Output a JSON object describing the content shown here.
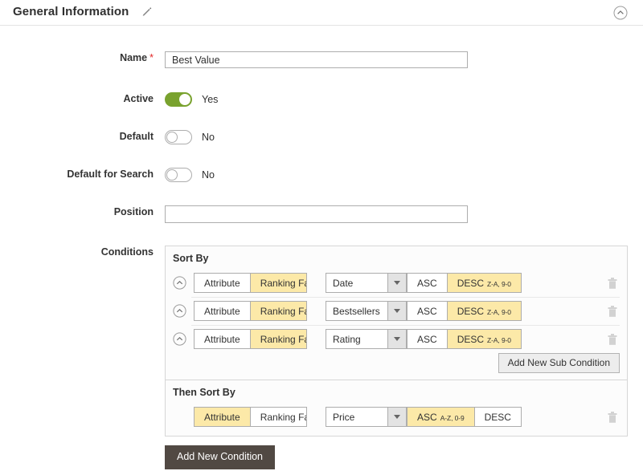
{
  "header": {
    "title": "General Information",
    "edit_icon": "pencil-icon",
    "collapse_icon": "chevron-up-circle-icon"
  },
  "form": {
    "name": {
      "label": "Name",
      "required_marker": "*",
      "value": "Best Value",
      "placeholder": ""
    },
    "active": {
      "label": "Active",
      "state": "Yes",
      "on": true
    },
    "default": {
      "label": "Default",
      "state": "No",
      "on": false
    },
    "default_for_search": {
      "label": "Default for Search",
      "state": "No",
      "on": false
    },
    "position": {
      "label": "Position",
      "value": "",
      "placeholder": ""
    },
    "conditions": {
      "label": "Conditions"
    }
  },
  "conditions": {
    "groups": [
      {
        "title": "Sort By",
        "rows": [
          {
            "chevron_icon": "chevron-up-circle-icon",
            "type_options": [
              "Attribute",
              "Ranking Factor"
            ],
            "type_selected": "Ranking Factor",
            "field_value": "Date",
            "direction_options": [
              "ASC",
              "DESC"
            ],
            "direction_selected": "DESC",
            "direction_sub": "Z-A, 9-0",
            "delete_icon": "trash-icon"
          },
          {
            "chevron_icon": "chevron-up-circle-icon",
            "type_options": [
              "Attribute",
              "Ranking Factor"
            ],
            "type_selected": "Ranking Factor",
            "field_value": "Bestsellers",
            "direction_options": [
              "ASC",
              "DESC"
            ],
            "direction_selected": "DESC",
            "direction_sub": "Z-A, 9-0",
            "delete_icon": "trash-icon"
          },
          {
            "chevron_icon": "chevron-up-circle-icon",
            "type_options": [
              "Attribute",
              "Ranking Factor"
            ],
            "type_selected": "Ranking Factor",
            "field_value": "Rating",
            "direction_options": [
              "ASC",
              "DESC"
            ],
            "direction_selected": "DESC",
            "direction_sub": "Z-A, 9-0",
            "delete_icon": "trash-icon"
          }
        ],
        "add_sub_condition_label": "Add New Sub Condition"
      },
      {
        "title": "Then Sort By",
        "rows": [
          {
            "chevron_icon": "none",
            "type_options": [
              "Attribute",
              "Ranking Factor"
            ],
            "type_selected": "Attribute",
            "field_value": "Price",
            "direction_options": [
              "ASC",
              "DESC"
            ],
            "direction_selected": "ASC",
            "direction_sub": "A-Z, 0-9",
            "delete_icon": "trash-icon"
          }
        ],
        "add_sub_condition_label": ""
      }
    ],
    "add_condition_label": "Add New Condition"
  },
  "colors": {
    "accent_yellow": "#fce9a8",
    "toggle_on_green": "#79a22e",
    "button_dark": "#514943",
    "required_red": "#e22626",
    "border_gray": "#adadad"
  }
}
